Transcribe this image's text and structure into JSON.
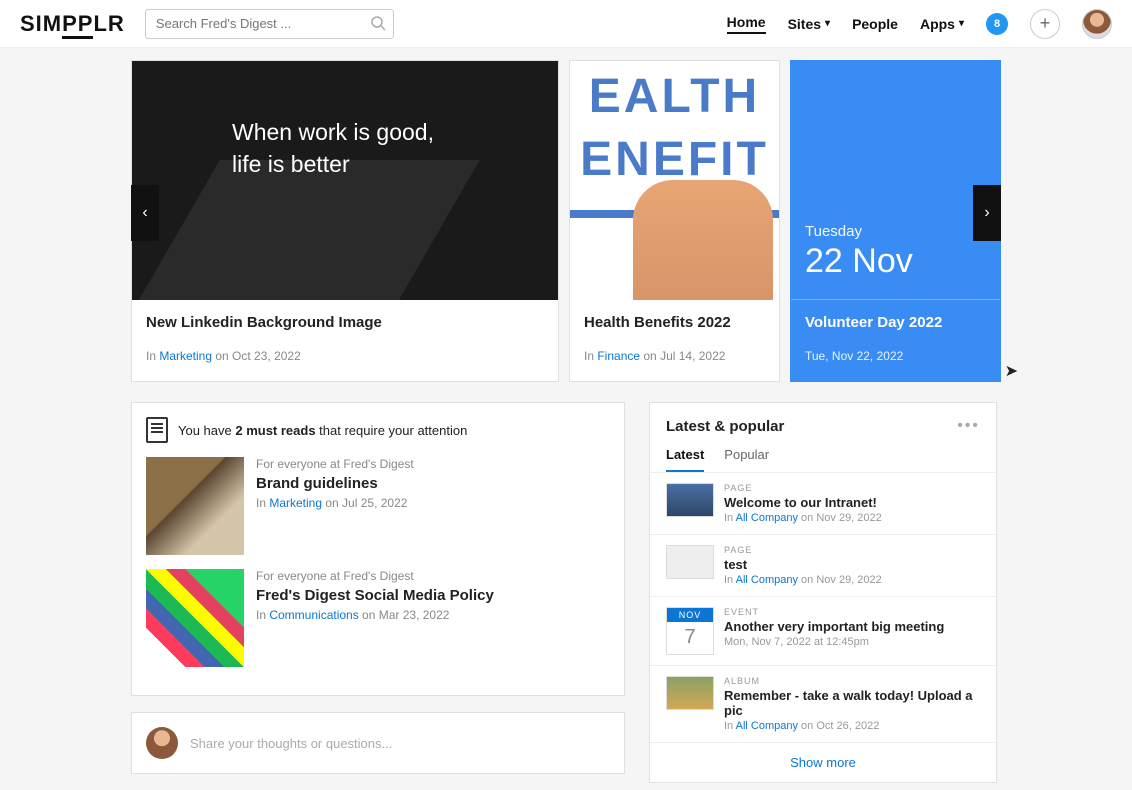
{
  "header": {
    "logo": "SIMPPLR",
    "search_placeholder": "Search Fred's Digest ...",
    "nav": {
      "home": "Home",
      "sites": "Sites",
      "people": "People",
      "apps": "Apps"
    },
    "badge_count": "8"
  },
  "carousel": {
    "card1": {
      "image_text": "When work is good,\nlife is better",
      "title": "New Linkedin Background Image",
      "meta_prefix": "In ",
      "meta_link": "Marketing",
      "meta_suffix": " on Oct 23, 2022"
    },
    "card2": {
      "img_line1": "EALTH",
      "img_line2": "ENEFIT",
      "title": "Health Benefits 2022",
      "meta_prefix": "In ",
      "meta_link": "Finance",
      "meta_suffix": " on Jul 14, 2022"
    },
    "card3": {
      "dow": "Tuesday",
      "date": "22 Nov",
      "title": "Volunteer Day 2022",
      "sub": "Tue, Nov 22, 2022"
    }
  },
  "mustread": {
    "head_pre": "You have ",
    "head_bold": "2 must reads",
    "head_post": " that require your attention",
    "items": [
      {
        "audience": "For everyone at Fred's Digest",
        "title": "Brand guidelines",
        "meta_prefix": "In ",
        "meta_link": "Marketing",
        "meta_suffix": " on Jul 25, 2022"
      },
      {
        "audience": "For everyone at Fred's Digest",
        "title": "Fred's Digest Social Media Policy",
        "meta_prefix": "In ",
        "meta_link": "Communications",
        "meta_suffix": " on Mar 23, 2022"
      }
    ]
  },
  "latest": {
    "title": "Latest & popular",
    "tab_latest": "Latest",
    "tab_popular": "Popular",
    "items": [
      {
        "tag": "PAGE",
        "title": "Welcome to our Intranet!",
        "meta_prefix": "In ",
        "meta_link": "All Company",
        "meta_suffix": " on Nov 29, 2022"
      },
      {
        "tag": "PAGE",
        "title": "test",
        "meta_prefix": "In ",
        "meta_link": "All Company",
        "meta_suffix": " on Nov 29, 2022"
      },
      {
        "tag": "EVENT",
        "month": "NOV",
        "day": "7",
        "title": "Another very important big meeting",
        "sub": "Mon, Nov 7, 2022 at 12:45pm"
      },
      {
        "tag": "ALBUM",
        "title": "Remember - take a walk today! Upload a pic",
        "meta_prefix": "In ",
        "meta_link": "All Company",
        "meta_suffix": " on Oct 26, 2022"
      }
    ],
    "showmore": "Show more"
  },
  "share": {
    "placeholder": "Share your thoughts or questions..."
  }
}
